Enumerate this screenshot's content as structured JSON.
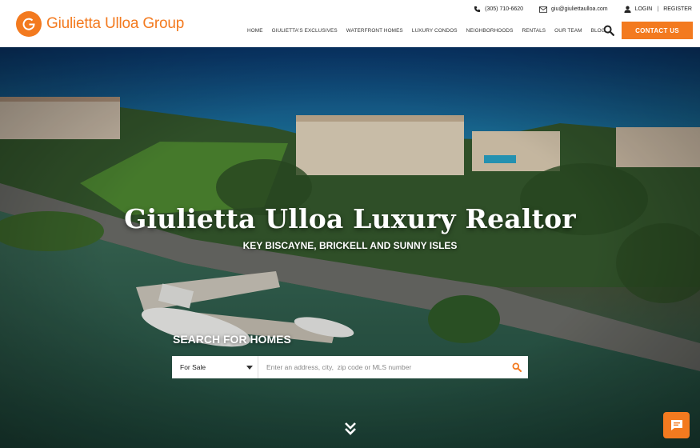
{
  "brand": {
    "name": "Giulietta Ulloa Group",
    "color": "#f37a1f"
  },
  "topbar": {
    "phone": "(305) 710-6620",
    "email": "giu@giuliettaulloa.com",
    "login": "LOGIN",
    "separator": "|",
    "register": "REGISTER"
  },
  "nav": {
    "items": [
      "HOME",
      "GIULIETTA'S EXCLUSIVES",
      "WATERFRONT HOMES",
      "LUXURY CONDOS",
      "NEIGHBORHOODS",
      "RENTALS",
      "OUR TEAM",
      "BLOG"
    ],
    "contact_label": "CONTACT US"
  },
  "hero": {
    "title": "Giulietta Ulloa Luxury Realtor",
    "subtitle": "KEY BISCAYNE, BRICKELL AND SUNNY ISLES"
  },
  "search": {
    "label": "SEARCH FOR HOMES",
    "type_selected": "For Sale",
    "placeholder": "Enter an address, city,  zip code or MLS number"
  },
  "icons": {
    "phone": "phone-icon",
    "email": "envelope-icon",
    "user": "user-icon",
    "search": "search-icon",
    "chevron": "caret-down-icon",
    "scroll": "double-chevron-down-icon",
    "chat": "chat-bubble-icon"
  }
}
